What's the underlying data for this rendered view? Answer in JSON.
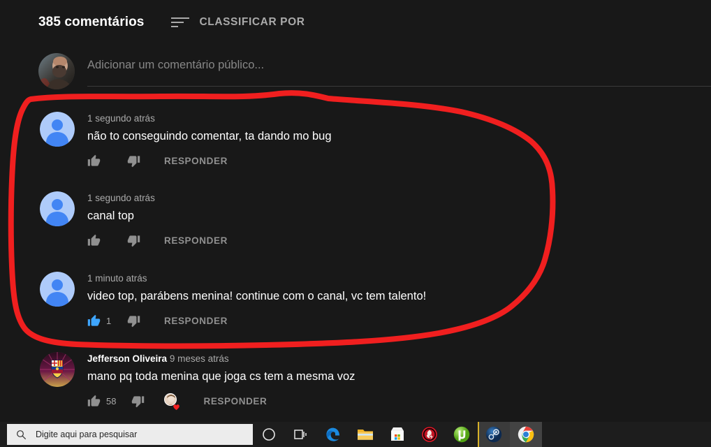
{
  "header": {
    "comment_count": "385 comentários",
    "sort_label": "CLASSIFICAR POR",
    "sort_icon": "sort-lines-icon"
  },
  "add_comment": {
    "placeholder": "Adicionar um comentário público...",
    "avatar_alt": "kratos-avatar"
  },
  "comments": [
    {
      "author": "",
      "time": "1 segundo atrás",
      "text": "não to conseguindo comentar, ta dando mo bug",
      "likes": "",
      "liked": false,
      "reply_label": "RESPONDER",
      "avatar_type": "default-person",
      "has_heart": false
    },
    {
      "author": "",
      "time": "1 segundo atrás",
      "text": "canal top",
      "likes": "",
      "liked": false,
      "reply_label": "RESPONDER",
      "avatar_type": "default-person",
      "has_heart": false
    },
    {
      "author": "",
      "time": "1 minuto atrás",
      "text": "video top, parábens menina! continue com o canal, vc tem talento!",
      "likes": "1",
      "liked": true,
      "reply_label": "RESPONDER",
      "avatar_type": "default-person",
      "has_heart": false
    },
    {
      "author": "Jefferson Oliveira",
      "time": "9 meses atrás",
      "text": "mano pq toda menina que joga cs tem a mesma voz",
      "likes": "58",
      "liked": false,
      "reply_label": "RESPONDER",
      "avatar_type": "barcelona-crest",
      "has_heart": true
    }
  ],
  "annotation": {
    "shape": "hand-drawn-red-loop",
    "color": "#f01f1f"
  },
  "taskbar": {
    "search_placeholder": "Digite aqui para pesquisar",
    "items": [
      {
        "name": "cortana-icon"
      },
      {
        "name": "task-view-icon"
      },
      {
        "name": "edge-icon"
      },
      {
        "name": "file-explorer-icon"
      },
      {
        "name": "microsoft-store-icon"
      },
      {
        "name": "game-launcher-icon"
      },
      {
        "name": "utorrent-icon"
      },
      {
        "name": "steam-icon"
      },
      {
        "name": "chrome-icon"
      }
    ]
  },
  "colors": {
    "background": "#181818",
    "text_primary": "#ffffff",
    "text_secondary": "#aaaaaa",
    "link_blue": "#3ea6ff",
    "annotation_red": "#f01f1f"
  }
}
